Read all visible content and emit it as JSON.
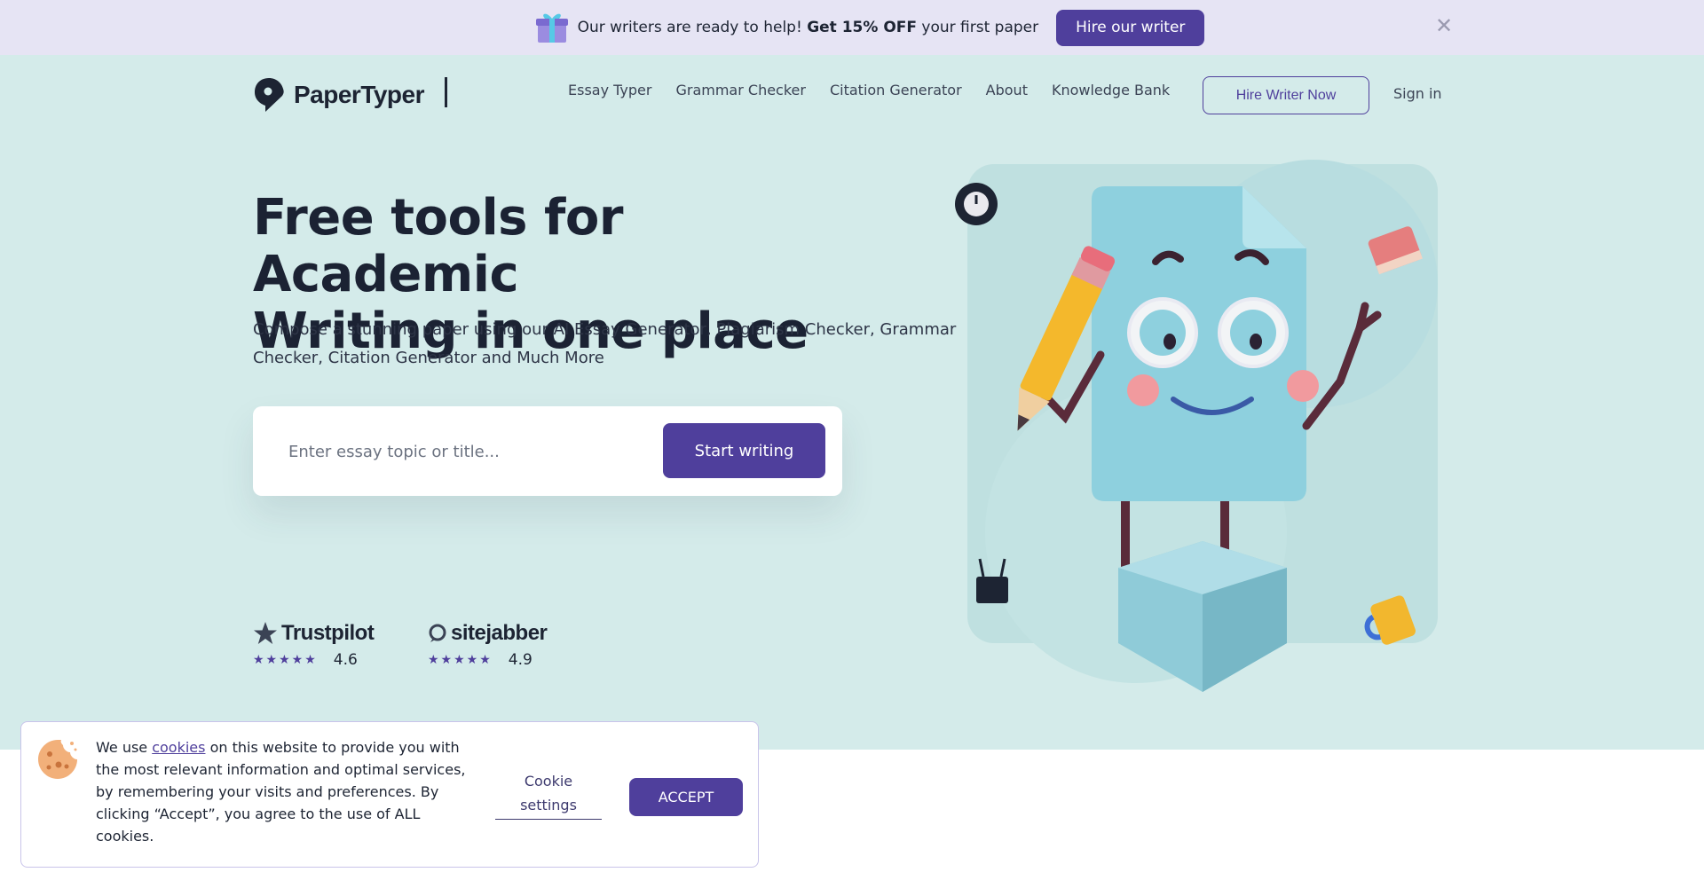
{
  "promo": {
    "text_before": "Our writers are ready to help! ",
    "text_bold": "Get 15% OFF",
    "text_after": " your first paper",
    "button_label": "Hire our writer",
    "close_glyph": "✕"
  },
  "header": {
    "logo_text": "PaperTyper",
    "nav_items": [
      {
        "label": "Essay Typer"
      },
      {
        "label": "Grammar Checker"
      },
      {
        "label": "Citation Generator"
      },
      {
        "label": "About"
      },
      {
        "label": "Knowledge Bank"
      }
    ],
    "hire_button": "Hire Writer Now",
    "sign_in": "Sign in"
  },
  "hero": {
    "title_line1": "Free tools for Academic",
    "title_line2": "Writing in one place",
    "subtitle": "Compose a stunning paper using our AI Essay Generator, Plagiarism Checker, Grammar Checker, Citation Generator and Much More",
    "search_placeholder": "Enter essay topic or title...",
    "start_button": "Start writing"
  },
  "ratings": [
    {
      "brand": "Trustpilot",
      "stars": "★★★★★",
      "score": "4.6"
    },
    {
      "brand": "sitejabber",
      "stars": "★★★★★",
      "score": "4.9"
    }
  ],
  "cookie": {
    "text_before": "We use ",
    "link_text": "cookies",
    "text_after": " on this website to provide you with the most relevant information and optimal services, by remembering your visits and preferences. By clicking “Accept”, you agree to the use of ALL cookies.",
    "settings_label": "Cookie settings",
    "accept_label": "ACCEPT"
  },
  "colors": {
    "accent": "#4f3f9c",
    "hero_bg": "#d4ebea",
    "promo_bg": "#e6e4f4",
    "mascot": "#8ed0de"
  },
  "icons": [
    "gift-icon",
    "close-icon",
    "logo-icon",
    "trustpilot-star-icon",
    "sitejabber-icon",
    "cookie-icon"
  ]
}
